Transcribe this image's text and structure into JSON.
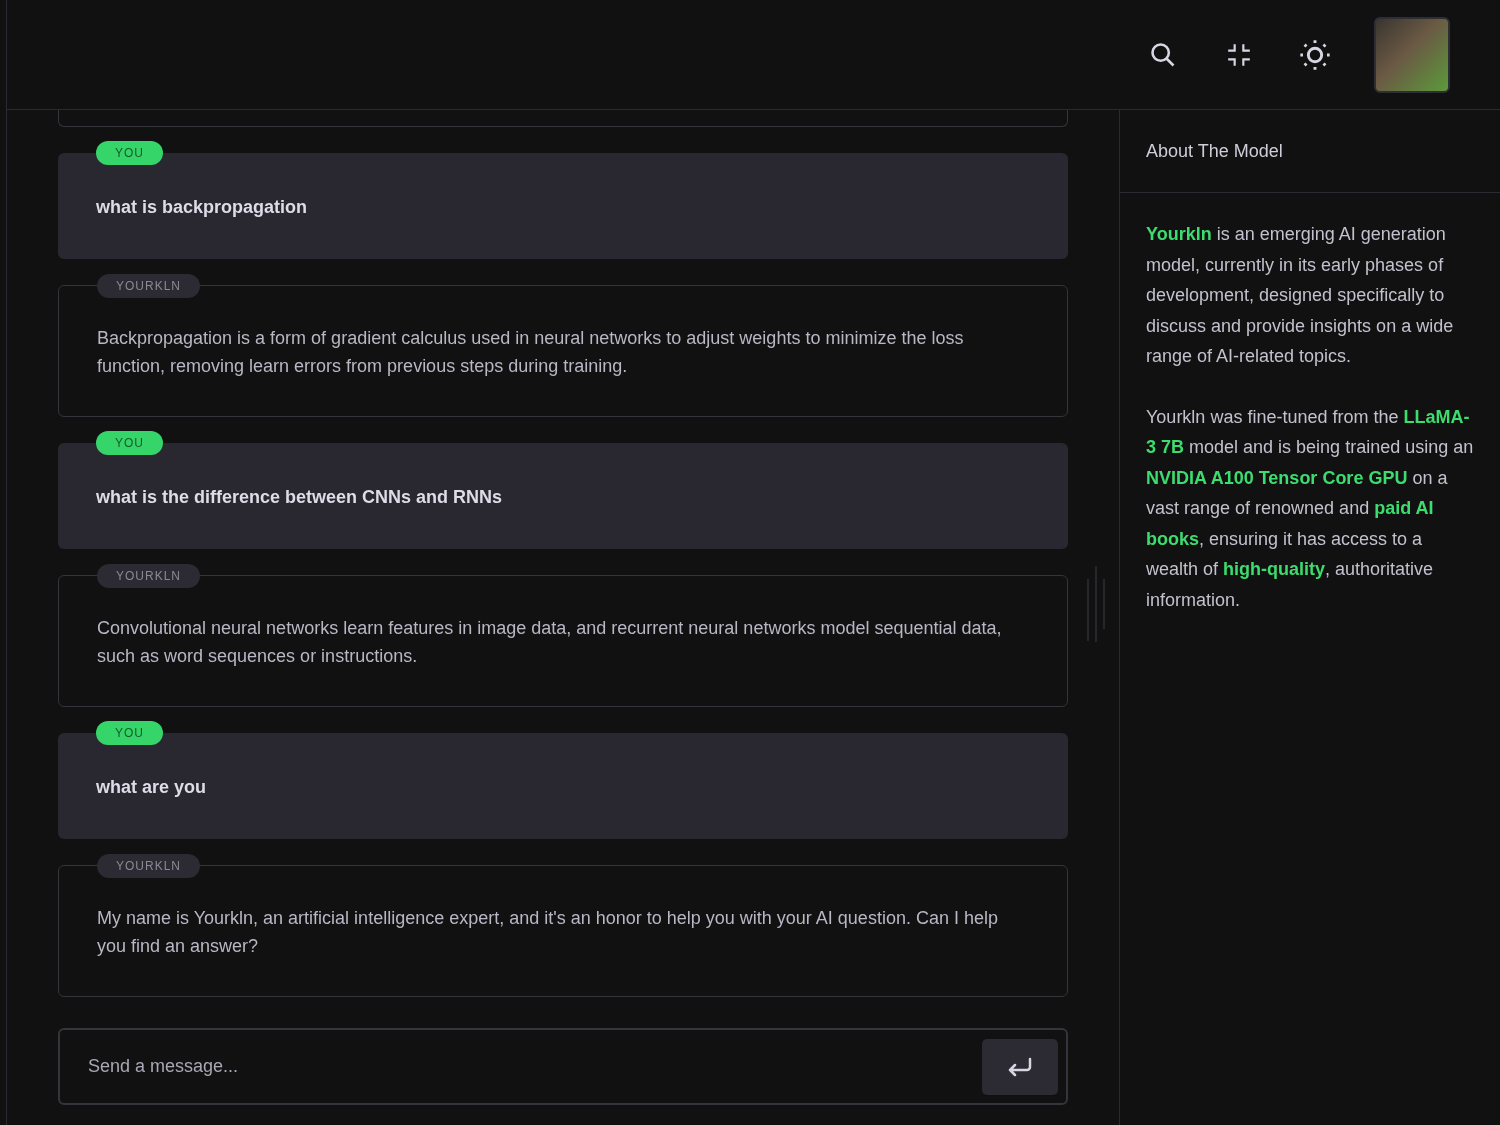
{
  "header": {
    "icons": [
      {
        "kind": "search"
      },
      {
        "kind": "collapse"
      },
      {
        "kind": "theme"
      }
    ]
  },
  "messages": [
    {
      "kind": "user",
      "sender": "YOU",
      "text": "what is backpropagation"
    },
    {
      "kind": "bot",
      "sender": "YOURKLN",
      "text": "Backpropagation is a form of gradient calculus used in neural networks to adjust weights to minimize the loss function, removing learn errors from previous steps during training."
    },
    {
      "kind": "user",
      "sender": "YOU",
      "text": "what is the difference between CNNs and RNNs"
    },
    {
      "kind": "bot",
      "sender": "YOURKLN",
      "text": "Convolutional neural networks learn features in image data, and recurrent neural networks model sequential data, such as word sequences or instructions."
    },
    {
      "kind": "user",
      "sender": "YOU",
      "text": "what are you"
    },
    {
      "kind": "bot",
      "sender": "YOURKLN",
      "text": "My name is Yourkln, an artificial intelligence expert, and it's an honor to help you with your AI question. Can I help you find an answer?"
    }
  ],
  "composer": {
    "placeholder": "Send a message..."
  },
  "sidebar": {
    "title": "About The Model",
    "paragraphs": [
      "**Yourkln** is an emerging AI generation model, currently in its early phases of development, designed specifically to discuss and provide insights on a wide range of AI-related topics.",
      "Yourkln was fine-tuned from the **LLaMA-3 7B** model and is being trained using an **NVIDIA A100 Tensor Core GPU** on a vast range of renowned and **paid AI books**, ensuring it has access to a wealth of **high-quality**, authoritative information."
    ]
  }
}
